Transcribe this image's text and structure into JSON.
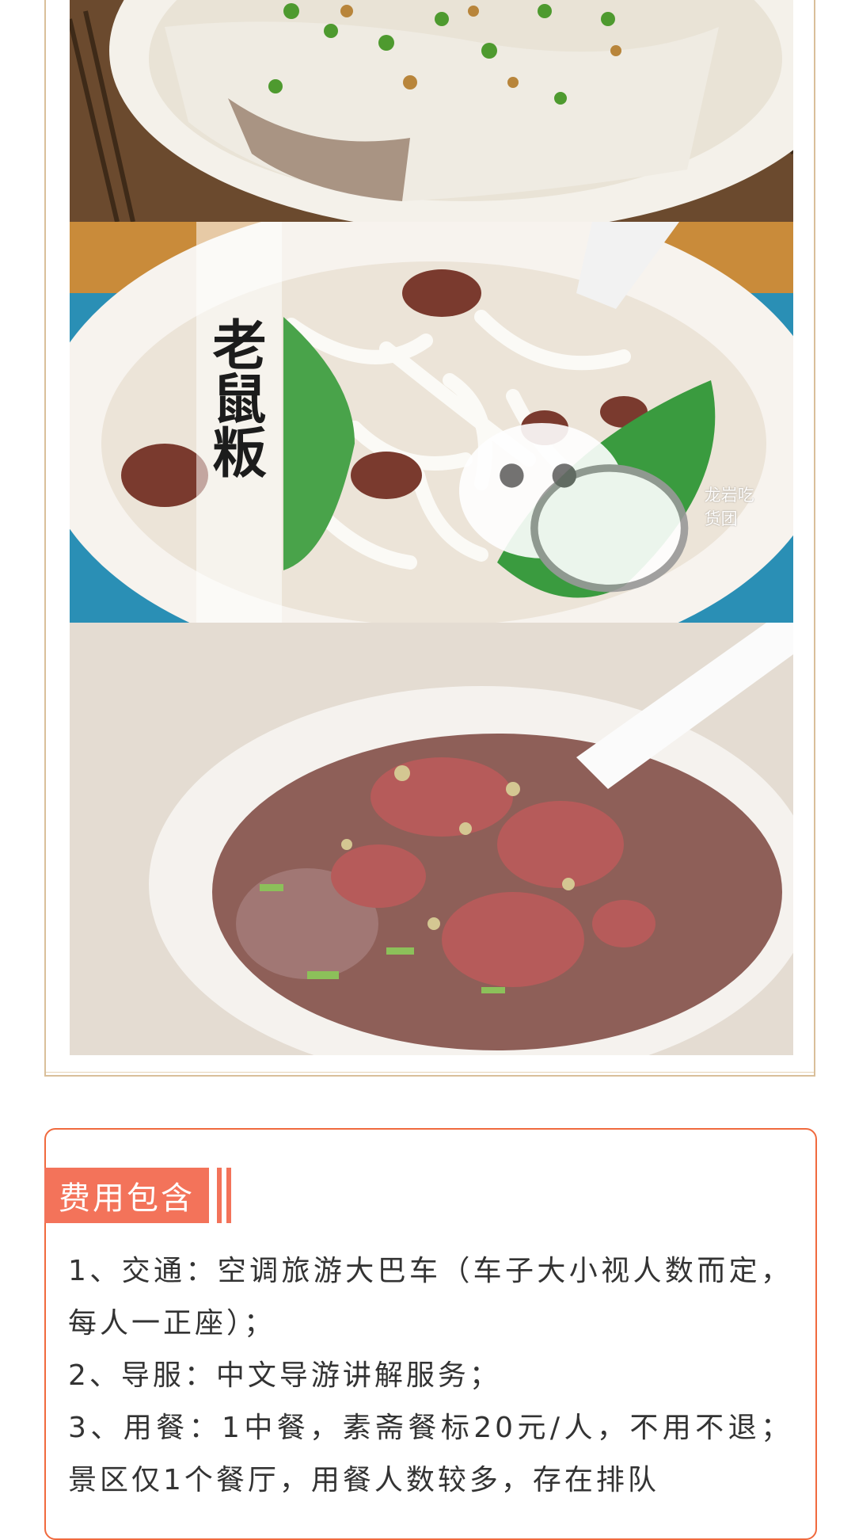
{
  "dish": {
    "title": "老鼠粄",
    "watermark": "龙岩吃货团"
  },
  "fee_section": {
    "heading": "费用包含",
    "items": [
      "1、交通：空调旅游大巴车（车子大小视人数而定，每人一正座）；",
      "2、导服：中文导游讲解服务；",
      "3、用餐：1中餐，素斋餐标20元/人，不用不退；景区仅1个餐厅，用餐人数较多，存在排队"
    ]
  },
  "colors": {
    "frame_gold": "#d9bf9a",
    "accent_orange": "#f3735a",
    "border_orange": "#f06a3e"
  },
  "icons": [
    "wechat-icon"
  ]
}
